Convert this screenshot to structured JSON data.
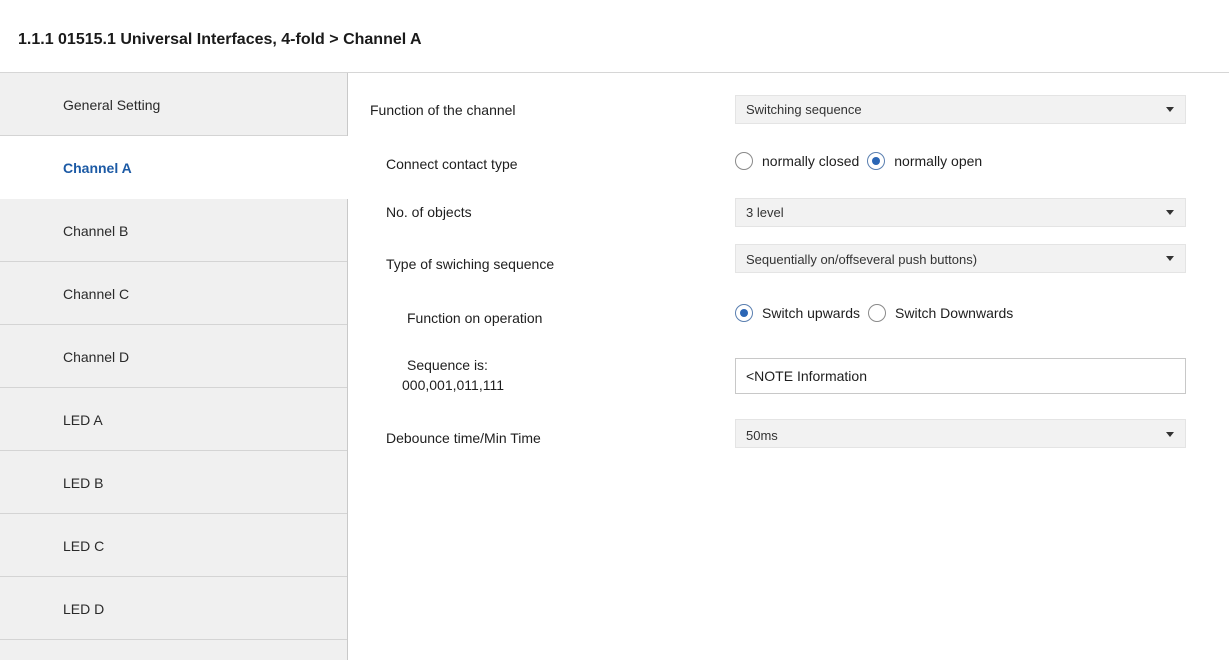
{
  "header": {
    "title": "1.1.1 01515.1 Universal Interfaces, 4-fold > Channel A"
  },
  "sidebar": {
    "items": [
      {
        "label": "General Setting",
        "active": false
      },
      {
        "label": "Channel A",
        "active": true
      },
      {
        "label": "Channel B",
        "active": false
      },
      {
        "label": "Channel C",
        "active": false
      },
      {
        "label": "Channel D",
        "active": false
      },
      {
        "label": "LED A",
        "active": false
      },
      {
        "label": "LED B",
        "active": false
      },
      {
        "label": "LED C",
        "active": false
      },
      {
        "label": "LED D",
        "active": false
      }
    ]
  },
  "params": {
    "function_of_channel": {
      "label": "Function of the channel",
      "value": "Switching sequence"
    },
    "connect_contact_type": {
      "label": "Connect contact type",
      "options": [
        "normally closed",
        "normally open"
      ],
      "selected": "normally open"
    },
    "no_of_objects": {
      "label": "No. of objects",
      "value": "3 level"
    },
    "type_of_switching_sequence": {
      "label": "Type of swiching sequence",
      "value": "Sequentially on/offseveral push buttons)"
    },
    "function_on_operation": {
      "label": "Function on operation",
      "options": [
        "Switch upwards",
        "Switch Downwards"
      ],
      "selected": "Switch upwards"
    },
    "sequence": {
      "label_line1": "Sequence is:",
      "label_line2": "000,001,011,111",
      "value": "<NOTE Information"
    },
    "debounce_time": {
      "label": "Debounce time/Min Time",
      "value": "50ms"
    }
  },
  "colors": {
    "active_nav_text": "#1c5aa5",
    "sidebar_bg": "#f0f0f0",
    "radio_checked": "#2b66b5"
  },
  "icons": [
    "dropdown-arrow-icon",
    "radio-checked-icon",
    "radio-unchecked-icon"
  ]
}
